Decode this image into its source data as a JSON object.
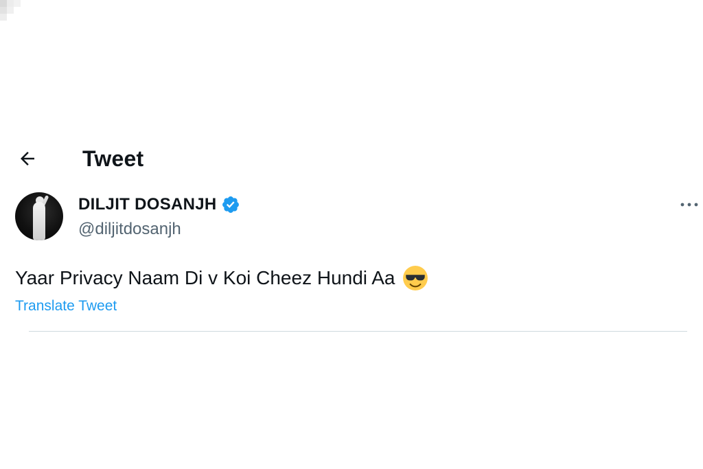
{
  "header": {
    "title": "Tweet",
    "back_icon": "arrow-left-icon"
  },
  "author": {
    "display_name": "DILJIT DOSANJH",
    "handle": "@diljitdosanjh",
    "verified_icon": "verified-badge-icon",
    "verified_color": "#1d9bf0"
  },
  "tweet": {
    "text": "Yaar Privacy Naam Di v Koi Cheez Hundi Aa",
    "emoji": "smiling-face-with-sunglasses-icon",
    "translate_label": "Translate Tweet"
  },
  "more_icon": "more-options-icon",
  "colors": {
    "accent": "#1d9bf0",
    "text": "#0f1419",
    "secondary_text": "#536471",
    "divider": "#cfd9de"
  }
}
